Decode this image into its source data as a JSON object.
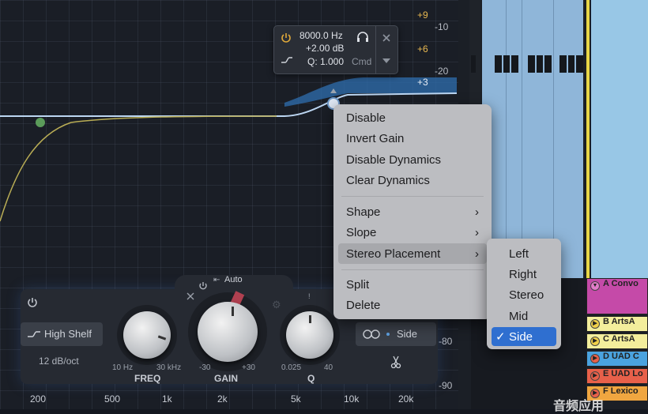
{
  "eq": {
    "db_scale_gold": [
      "+9",
      "+6",
      "+3"
    ],
    "db_scale_gray": [
      "-10",
      "-20",
      "-80",
      "-90"
    ],
    "freq_axis": [
      "200",
      "500",
      "1k",
      "2k",
      "5k",
      "10k",
      "20k"
    ]
  },
  "band_tooltip": {
    "frequency": "8000.0 Hz",
    "gain": "+2.00 dB",
    "q": "Q: 1.000",
    "modifier": "Cmd"
  },
  "panel": {
    "filter_shape": "High Shelf",
    "slope": "12 dB/oct",
    "auto_label": "Auto",
    "freq": {
      "label": "FREQ",
      "min": "10 Hz",
      "max": "30 kHz"
    },
    "gain": {
      "label": "GAIN",
      "min": "-30",
      "max": "+30"
    },
    "q": {
      "label": "Q",
      "min": "0.025",
      "max": "40"
    },
    "stereo_mode": "Side"
  },
  "context_menu": {
    "items": [
      "Disable",
      "Invert Gain",
      "Disable Dynamics",
      "Clear Dynamics"
    ],
    "submenus": [
      "Shape",
      "Slope",
      "Stereo Placement"
    ],
    "actions": [
      "Split",
      "Delete"
    ]
  },
  "stereo_submenu": {
    "options": [
      "Left",
      "Right",
      "Stereo",
      "Mid",
      "Side"
    ],
    "selected": "Side",
    "checkmark": "✓"
  },
  "tracks": [
    {
      "name": "A Convo",
      "color": "#c54aa8"
    },
    {
      "name": "B ArtsA",
      "color": "#f3ee9c"
    },
    {
      "name": "C ArtsA",
      "color": "#f3ee9c"
    },
    {
      "name": "D UAD C",
      "color": "#4aa3df"
    },
    {
      "name": "E UAD Lo",
      "color": "#e8604a"
    },
    {
      "name": "F Lexico",
      "color": "#f0a640"
    }
  ],
  "watermark": "音频应用"
}
